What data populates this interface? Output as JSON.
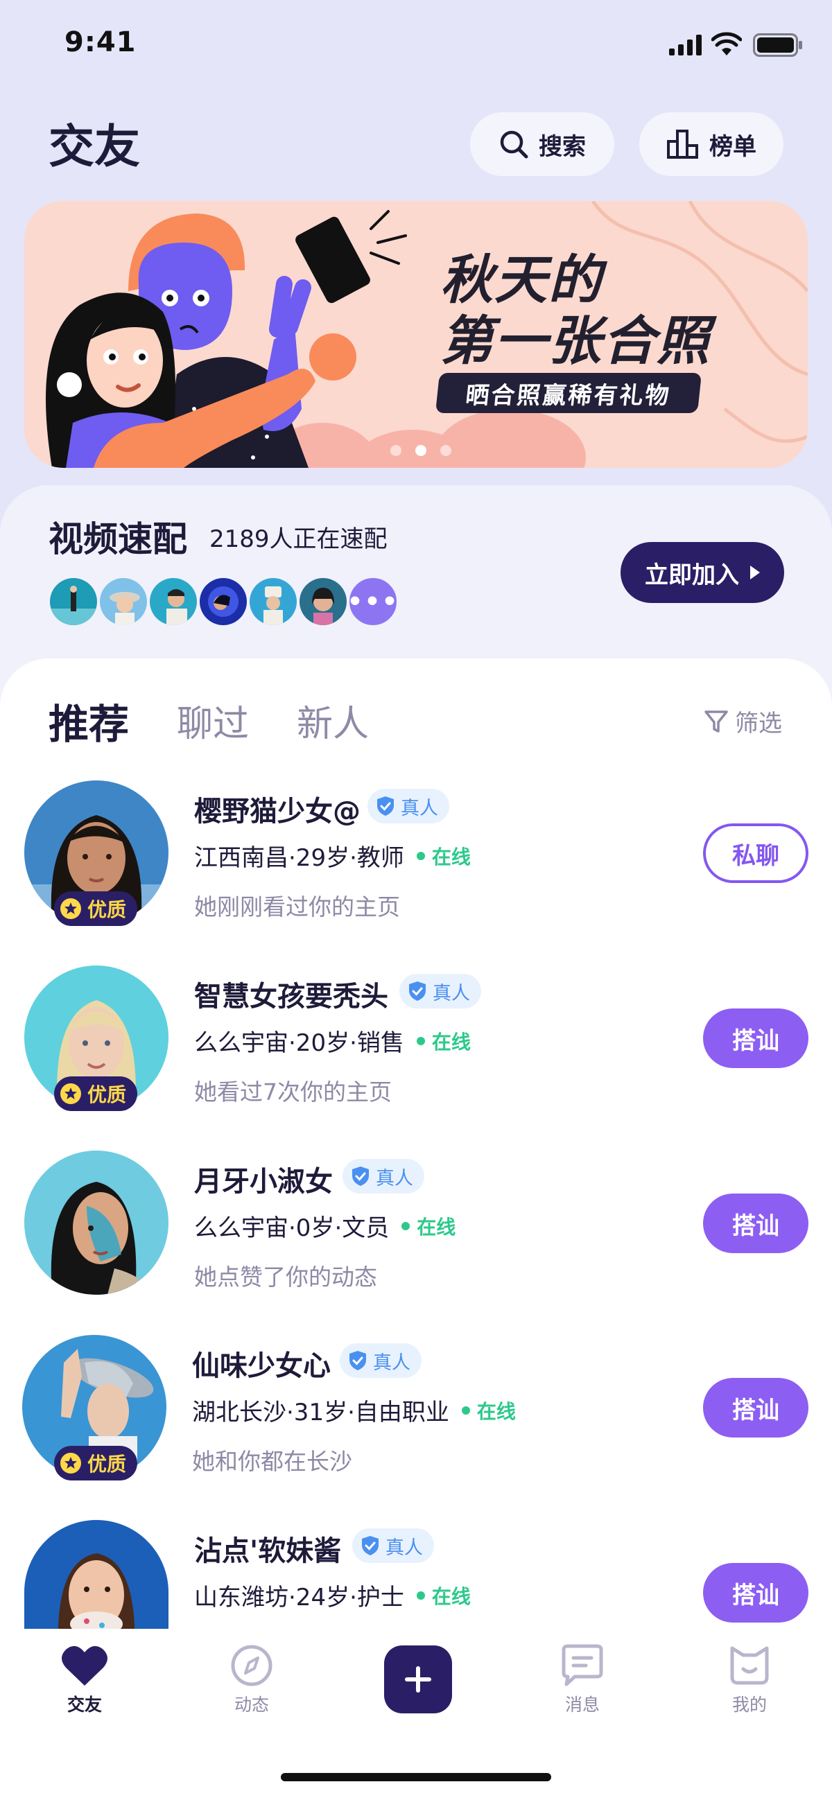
{
  "status": {
    "time": "9:41"
  },
  "header": {
    "title": "交友",
    "search_label": "搜索",
    "rank_label": "榜单"
  },
  "banner": {
    "title_line1": "秋天的",
    "title_line2": "第一张合照",
    "tag": "晒合照赢稀有礼物",
    "dots": 3,
    "active_dot": 1
  },
  "video": {
    "title": "视频速配",
    "count": "2189人正在速配",
    "more": "•••",
    "join_label": "立即加入"
  },
  "tabs": [
    {
      "label": "推荐",
      "active": true
    },
    {
      "label": "聊过",
      "active": false
    },
    {
      "label": "新人",
      "active": false
    }
  ],
  "filter_label": "筛选",
  "users": [
    {
      "name": "樱野猫少女@",
      "real": "真人",
      "info": "江西南昌·29岁·教师",
      "online": "在线",
      "note": "她刚刚看过你的主页",
      "badge": "优质",
      "action": "私聊"
    },
    {
      "name": "智慧女孩要秃头",
      "real": "真人",
      "info": "么么宇宙·20岁·销售",
      "online": "在线",
      "note": "她看过7次你的主页",
      "badge": "优质",
      "action": "搭讪"
    },
    {
      "name": "月牙小淑女",
      "real": "真人",
      "info": "么么宇宙·0岁·文员",
      "online": "在线",
      "note": "她点赞了你的动态",
      "badge": "",
      "action": "搭讪"
    },
    {
      "name": "仙味少女心",
      "real": "真人",
      "info": "湖北长沙·31岁·自由职业",
      "online": "在线",
      "note": "她和你都在长沙",
      "badge": "优质",
      "action": "搭讪"
    },
    {
      "name": "沾点'软妹酱",
      "real": "真人",
      "info": "山东潍坊·24岁·护士",
      "online": "在线",
      "note": "",
      "badge": "",
      "action": "搭讪"
    }
  ],
  "nav": [
    {
      "label": "交友",
      "icon": "heart-icon",
      "active": true
    },
    {
      "label": "动态",
      "icon": "compass-icon",
      "active": false
    },
    {
      "label": "",
      "icon": "plus-icon",
      "active": false
    },
    {
      "label": "消息",
      "icon": "message-icon",
      "active": false
    },
    {
      "label": "我的",
      "icon": "profile-icon",
      "active": false
    }
  ],
  "colors": {
    "accent": "#8d5ef2",
    "dark": "#2a1f66",
    "online": "#2cc98b",
    "verified": "#4a90f0"
  }
}
